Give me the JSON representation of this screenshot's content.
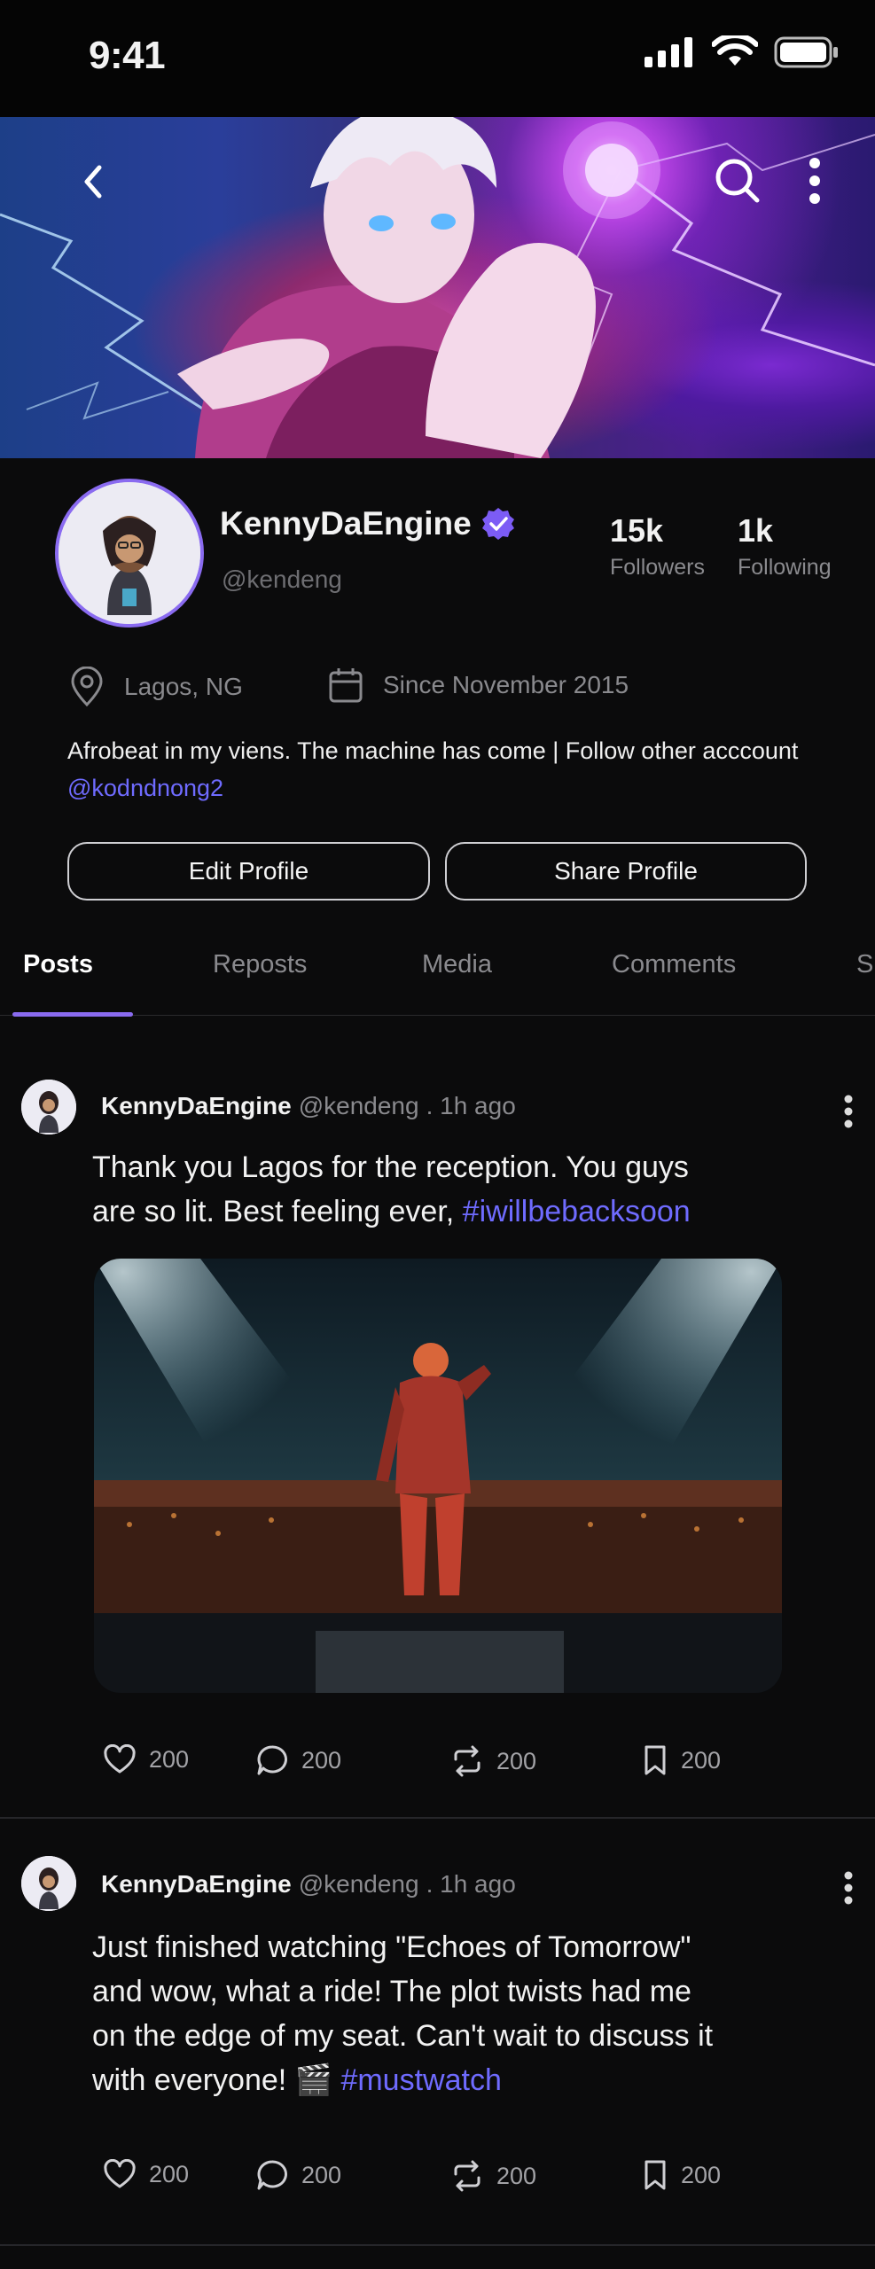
{
  "status": {
    "time": "9:41"
  },
  "profile": {
    "name": "KennyDaEngine",
    "handle": "@kendeng",
    "followers_count": "15k",
    "followers_label": "Followers",
    "following_count": "1k",
    "following_label": "Following",
    "location": "Lagos, NG",
    "joined": "Since November 2015",
    "bio_text": "Afrobeat in my viens. The machine has come | Follow other acccount",
    "bio_link": "@kodndnong2",
    "edit_button": "Edit Profile",
    "share_button": "Share Profile"
  },
  "tabs": [
    "Posts",
    "Reposts",
    "Media",
    "Comments",
    "S"
  ],
  "posts": [
    {
      "name": "KennyDaEngine",
      "handle": "@kendeng",
      "time": ". 1h ago",
      "text_lines": [
        "Thank you Lagos for the reception. You guys",
        "are so lit. Best feeling ever, "
      ],
      "hashtag": "#iwillbebacksoon",
      "likes": "200",
      "comments": "200",
      "reposts": "200",
      "saves": "200"
    },
    {
      "name": "KennyDaEngine",
      "handle": "@kendeng",
      "time": ". 1h ago",
      "text_lines": [
        "Just finished watching \"Echoes of Tomorrow\"",
        "and wow, what a ride! The plot twists had me",
        "on the edge of my seat. Can't wait to discuss it",
        "with everyone! 🎬 "
      ],
      "hashtag": "#mustwatch",
      "likes": "200",
      "comments": "200",
      "reposts": "200",
      "saves": "200"
    }
  ],
  "colors": {
    "accent": "#8a6bf0",
    "link": "#6f6bff",
    "background": "#0b0b0c"
  },
  "icons": [
    "back-icon",
    "search-icon",
    "more-vertical-icon",
    "verified-badge-icon",
    "location-pin-icon",
    "calendar-icon",
    "heart-icon",
    "comment-icon",
    "repost-icon",
    "bookmark-icon",
    "signal-icon",
    "wifi-icon",
    "battery-icon"
  ]
}
